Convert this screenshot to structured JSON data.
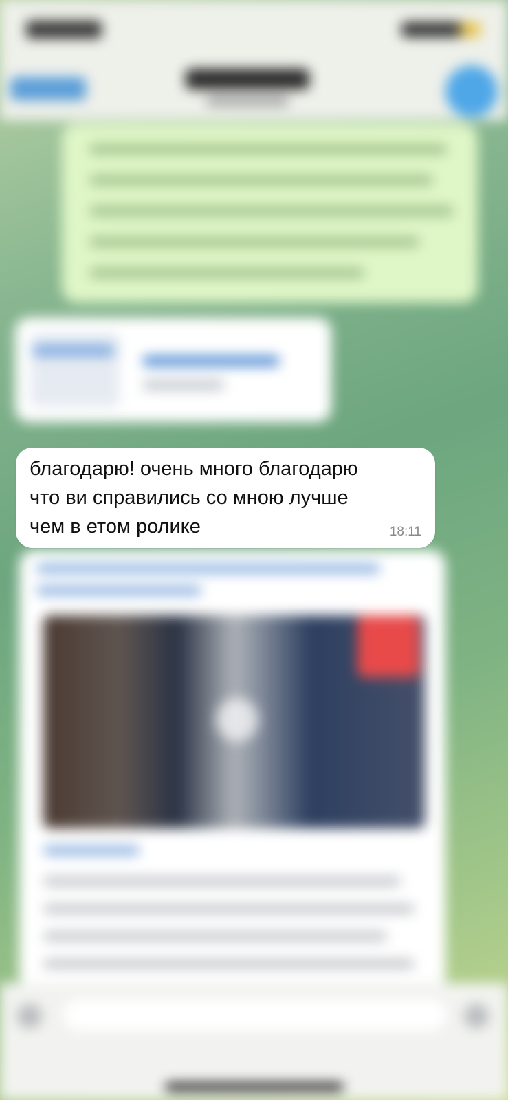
{
  "chat": {
    "message": {
      "text": "благодарю! очень много благодарю\nчто ви справились со мною лучше\nчем в етом ролике",
      "time": "18:11"
    }
  },
  "colors": {
    "header_bg": "#eef0ea",
    "incoming_bubble": "#ffffff",
    "outgoing_bubble": "#dff6c7",
    "accent": "#4fa7e8",
    "wallpaper": "#6fa77e"
  },
  "icons": [
    "back-icon",
    "avatar",
    "play-icon",
    "attach-icon",
    "mic-icon"
  ]
}
